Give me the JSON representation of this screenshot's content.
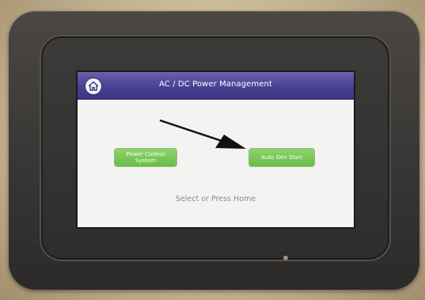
{
  "screen": {
    "title": "AC / DC Power Management",
    "home_icon": "home-icon",
    "buttons": {
      "power_control_label": "Power Control\nSystem",
      "auto_gen_label": "Auto Gen Start"
    },
    "prompt": "Select or Press Home"
  },
  "colors": {
    "title_bar": "#4a4294",
    "button_green": "#6fc24a",
    "screen_bg": "#f3f3f1",
    "prompt_text": "#8c8c8c",
    "bezel": "#3a3836"
  }
}
